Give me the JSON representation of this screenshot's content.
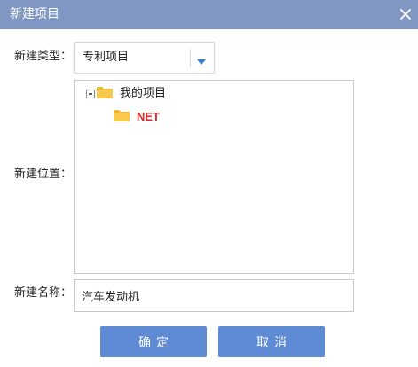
{
  "dialog": {
    "title": "新建项目",
    "close_icon": "close-icon"
  },
  "form": {
    "type_label": "新建类型：",
    "type_value": "专利项目",
    "location_label": "新建位置：",
    "name_label": "新建名称：",
    "name_value": "汽车发动机"
  },
  "tree": {
    "root": {
      "label": "我的项目",
      "expanded": true,
      "icon": "folder-icon"
    },
    "children": [
      {
        "label": "NET",
        "icon": "folder-icon",
        "color": "#e0292b"
      }
    ]
  },
  "buttons": {
    "ok_label": "确定",
    "cancel_label": "取消"
  },
  "colors": {
    "titlebar": "#7f97c2",
    "button": "#5e8bd3",
    "accent_arrow": "#2f7fcf",
    "folder": "#f2b531",
    "highlight_text": "#e0292b"
  }
}
